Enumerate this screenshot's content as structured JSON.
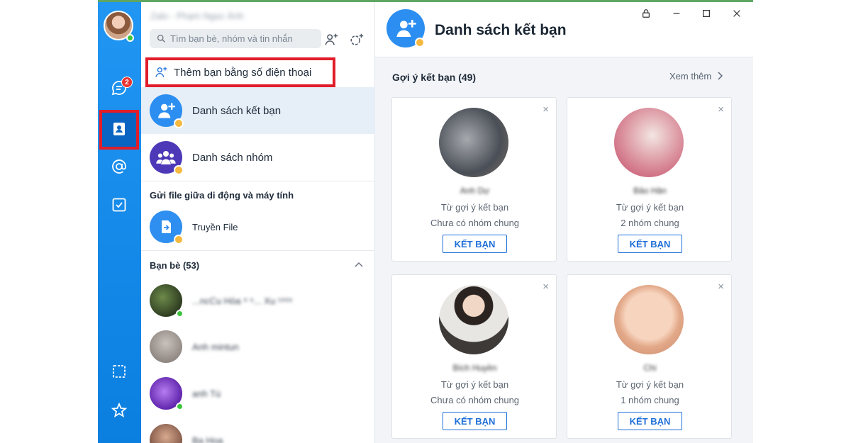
{
  "window": {
    "title": "Zalo - Phạm Ngọc Ánh",
    "controls": [
      "lock-icon",
      "minimize-icon",
      "maximize-icon",
      "close-icon"
    ]
  },
  "rail": {
    "unread_badge": "2",
    "items": [
      "chat-icon",
      "contacts-icon",
      "mention-icon",
      "todo-icon",
      "screenshot-icon",
      "star-icon"
    ]
  },
  "search": {
    "placeholder": "Tìm bạn bè, nhóm và tin nhắn"
  },
  "contacts_menu": {
    "add_by_phone": "Thêm bạn bằng số điện thoại",
    "friend_list": "Danh sách kết bạn",
    "group_list": "Danh sách nhóm",
    "file_section": "Gửi file giữa di động và máy tính",
    "file_transfer": "Truyền File",
    "friends_header": "Bạn bè (53)"
  },
  "friends": [
    {
      "name": "...ncCu Hòa ⁹ ⁵...   Xu ¹⁹⁹⁵"
    },
    {
      "name": "Anh mintun"
    },
    {
      "name": "anh Tú"
    },
    {
      "name": "Ba Hoa"
    }
  ],
  "main": {
    "title": "Danh sách kết bạn",
    "suggestions_title": "Gợi ý kết bạn (49)",
    "see_more": "Xem thêm"
  },
  "cards": [
    {
      "name": "Anh Dự",
      "source": "Từ gợi ý kết bạn",
      "mutual": "Chưa có nhóm chung",
      "button": "KẾT BẠN"
    },
    {
      "name": "Bảo Hân",
      "source": "Từ gợi ý kết bạn",
      "mutual": "2 nhóm chung",
      "button": "KẾT BẠN"
    },
    {
      "name": "Bích Huyền",
      "source": "Từ gợi ý kết bạn",
      "mutual": "Chưa có nhóm chung",
      "button": "KẾT BẠN"
    },
    {
      "name": "Chi",
      "source": "Từ gợi ý kết bạn",
      "mutual": "1 nhóm chung",
      "button": "KẾT BẠN"
    }
  ],
  "colors": {
    "rail_blue": "#0b7fe0",
    "accent": "#1e6fd9",
    "highlight_red": "#e11d2a",
    "active_row": "#e6eef8"
  }
}
